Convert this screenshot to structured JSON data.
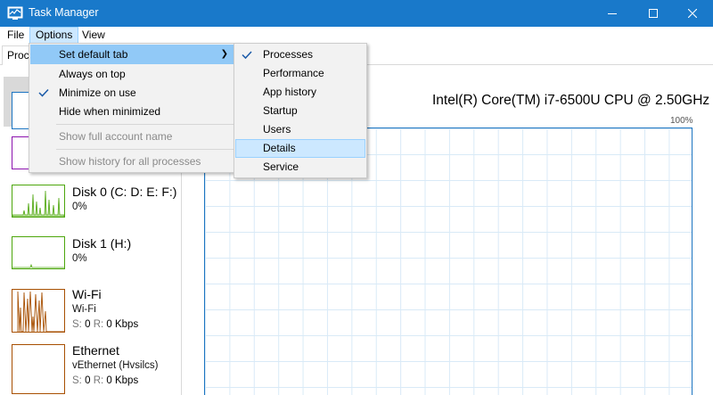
{
  "window": {
    "title": "Task Manager",
    "title_bar_color": "#1979ca"
  },
  "menubar": {
    "file": "File",
    "options": "Options",
    "view": "View"
  },
  "tabs": {
    "processes_partial": "Processes"
  },
  "options_menu": {
    "items": [
      {
        "label": "Set default tab",
        "checked": false,
        "submenu": true,
        "disabled": false
      },
      {
        "label": "Always on top",
        "checked": false,
        "submenu": false,
        "disabled": false
      },
      {
        "label": "Minimize on use",
        "checked": true,
        "submenu": false,
        "disabled": false
      },
      {
        "label": "Hide when minimized",
        "checked": false,
        "submenu": false,
        "disabled": false
      },
      {
        "label": "Show full account name",
        "checked": false,
        "submenu": false,
        "disabled": true
      },
      {
        "label": "Show history for all processes",
        "checked": false,
        "submenu": false,
        "disabled": true
      }
    ]
  },
  "default_tab_submenu": {
    "items": [
      {
        "label": "Processes",
        "checked": true
      },
      {
        "label": "Performance",
        "checked": false
      },
      {
        "label": "App history",
        "checked": false
      },
      {
        "label": "Startup",
        "checked": false
      },
      {
        "label": "Users",
        "checked": false
      },
      {
        "label": "Details",
        "checked": false,
        "highlighted": true
      },
      {
        "label": "Service",
        "checked": false
      }
    ]
  },
  "sidebar": {
    "disk0": {
      "name": "Disk 0 (C: D: E: F:)",
      "value": "0%",
      "color": "#4da60c"
    },
    "disk1": {
      "name": "Disk 1 (H:)",
      "value": "0%",
      "color": "#4da60c"
    },
    "wifi": {
      "name": "Wi-Fi",
      "adapter": "Wi-Fi",
      "s_label": "S:",
      "s_value": "0",
      "r_label": "R:",
      "r_value": "0 Kbps",
      "color": "#a74f01"
    },
    "ethernet": {
      "name": "Ethernet",
      "adapter": "vEthernet (Hvsilcs)",
      "s_label": "S:",
      "s_value": "0",
      "r_label": "R:",
      "r_value": "0 Kbps",
      "color": "#a74f01"
    },
    "cpu_color": "#1b74c1",
    "memory_color": "#8b12ae"
  },
  "main": {
    "cpu_model": "Intel(R) Core(TM) i7-6500U CPU @ 2.50GHz",
    "graph_max": "100%"
  }
}
